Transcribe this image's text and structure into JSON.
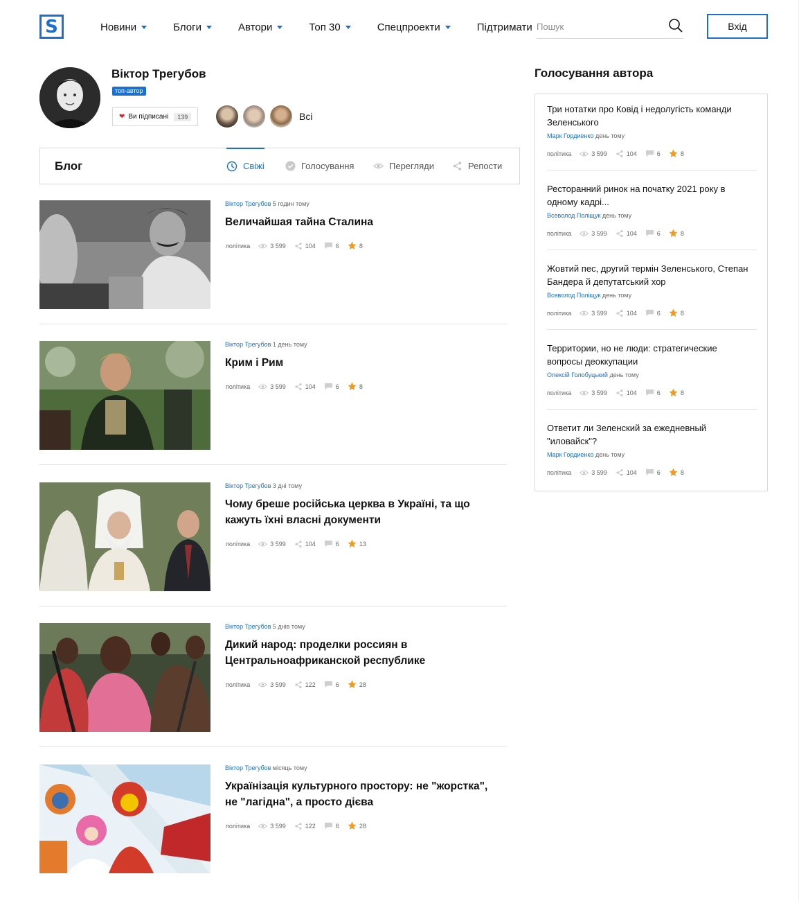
{
  "header": {
    "logo_letter": "S",
    "nav": [
      {
        "label": "Новини",
        "dropdown": true
      },
      {
        "label": "Блоги",
        "dropdown": true
      },
      {
        "label": "Автори",
        "dropdown": true
      },
      {
        "label": "Топ 30",
        "dropdown": true
      },
      {
        "label": "Спецпроекти",
        "dropdown": true
      },
      {
        "label": "Підтримати",
        "dropdown": false
      }
    ],
    "search_placeholder": "Пошук",
    "login_label": "Вхід"
  },
  "profile": {
    "name": "Віктор Трегубов",
    "badge": "топ-автор",
    "subscribe_label": "Ви підписані",
    "subscribe_count": "139",
    "all_label": "Всі"
  },
  "tabs": {
    "blog_title": "Блог",
    "items": [
      {
        "label": "Свіжі",
        "icon": "clock-icon",
        "active": true
      },
      {
        "label": "Голосування",
        "icon": "check-circle-icon",
        "active": false
      },
      {
        "label": "Перегляди",
        "icon": "eye-icon",
        "active": false
      },
      {
        "label": "Репости",
        "icon": "share-icon",
        "active": false
      }
    ]
  },
  "posts": [
    {
      "author": "Віктор Трегубов",
      "time": "5 годин тому",
      "title": "Величайшая тайна Сталина",
      "tag": "політика",
      "views": "3 599",
      "shares": "104",
      "comments": "6",
      "rating": "8"
    },
    {
      "author": "Віктор Трегубов",
      "time": "1 день тому",
      "title": "Крим і Рим",
      "tag": "політика",
      "views": "3 599",
      "shares": "104",
      "comments": "6",
      "rating": "8"
    },
    {
      "author": "Віктор Трегубов",
      "time": "3 дні тому",
      "title": "Чому бреше російська церква в Україні, та що кажуть їхні власні документи",
      "tag": "політика",
      "views": "3 599",
      "shares": "104",
      "comments": "6",
      "rating": "13"
    },
    {
      "author": "Віктор Трегубов",
      "time": "5 днів тому",
      "title": "Дикий народ: проделки россиян в Центральноафриканской республике",
      "tag": "політика",
      "views": "3 599",
      "shares": "122",
      "comments": "6",
      "rating": "28"
    },
    {
      "author": "Віктор Трегубов",
      "time": "місяць тому",
      "title": "Українізація культурного простору: не \"жорстка\", не \"лагідна\", а просто дієва",
      "tag": "політика",
      "views": "3 599",
      "shares": "122",
      "comments": "6",
      "rating": "28"
    }
  ],
  "sidebar": {
    "title": "Голосування автора",
    "items": [
      {
        "title": "Три нотатки про Ковід і недолугість команди Зеленського",
        "author": "Марк Гордиенко",
        "time": "день тому",
        "tag": "політика",
        "views": "3 599",
        "shares": "104",
        "comments": "6",
        "rating": "8"
      },
      {
        "title": "Ресторанний ринок на початку 2021 року в одному кадрі...",
        "author": "Всеволод Поліщук",
        "time": "день тому",
        "tag": "політика",
        "views": "3 599",
        "shares": "104",
        "comments": "6",
        "rating": "8"
      },
      {
        "title": "Жовтий пес, другий термін Зеленського, Степан Бандера й депутатський хор",
        "author": "Всеволод Поліщук",
        "time": "день тому",
        "tag": "політика",
        "views": "3 599",
        "shares": "104",
        "comments": "6",
        "rating": "8"
      },
      {
        "title": "Территории, но не люди: стратегические вопросы деоккупации",
        "author": "Олексій Голобуцький",
        "time": "день тому",
        "tag": "політика",
        "views": "3 599",
        "shares": "104",
        "comments": "6",
        "rating": "8"
      },
      {
        "title": "Ответит ли Зеленский за ежедневный \"иловайск\"?",
        "author": "Марк Гордиенко",
        "time": "день тому",
        "tag": "політика",
        "views": "3 599",
        "shares": "104",
        "comments": "6",
        "rating": "8"
      }
    ]
  },
  "colors": {
    "accent": "#1a6fd0",
    "star": "#f39a1e",
    "heart": "#e0252b"
  }
}
